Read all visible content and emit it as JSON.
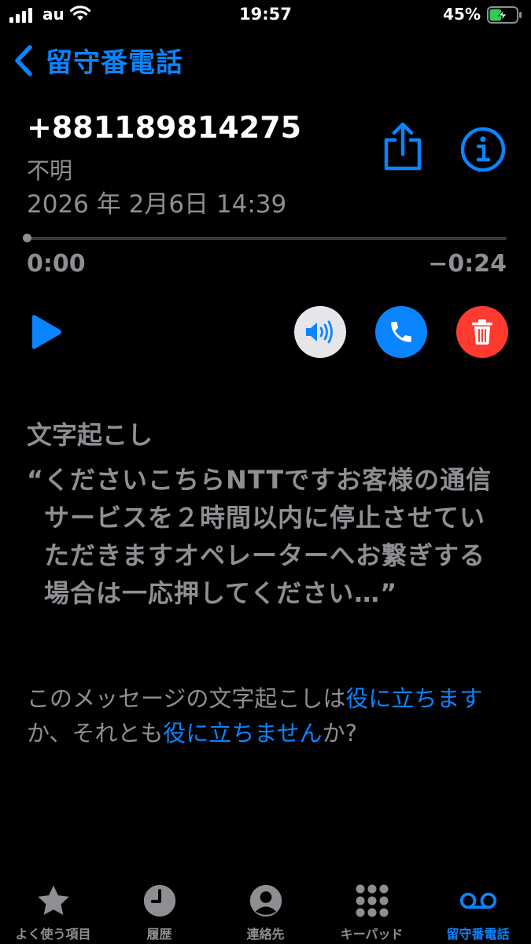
{
  "status_bar": {
    "carrier": "au",
    "time": "19:57",
    "battery_percent": "45%",
    "battery_level": 0.45
  },
  "nav": {
    "back_label": "留守番電話"
  },
  "voicemail": {
    "number": "+881189814275",
    "caller_label": "不明",
    "date": "2026 年 2月6日 14:39",
    "elapsed": "0:00",
    "remaining": "−0:24",
    "progress": 0
  },
  "transcription": {
    "title": "文字起こし",
    "open_quote": "“",
    "text": "くださいこちらNTTですお客様の通信サービスを２時間以内に停止させていただきますオペレーターへお繋ぎする場合は一応押してください…”"
  },
  "feedback": {
    "prefix": "このメッセージの文字起こしは",
    "helpful_link": "役に立ちます",
    "middle": "か、それとも",
    "not_helpful_link": "役に立ちません",
    "suffix": "か?"
  },
  "tabs": [
    {
      "label": "よく使う項目",
      "icon": "star-icon",
      "active": false
    },
    {
      "label": "履歴",
      "icon": "clock-icon",
      "active": false
    },
    {
      "label": "連絡先",
      "icon": "person-icon",
      "active": false
    },
    {
      "label": "キーパッド",
      "icon": "keypad-icon",
      "active": false
    },
    {
      "label": "留守番電話",
      "icon": "voicemail-icon",
      "active": true
    }
  ],
  "colors": {
    "accent": "#0a84ff",
    "secondary_text": "#8e8e93",
    "delete": "#ff3b30",
    "battery_fill": "#34c759"
  }
}
